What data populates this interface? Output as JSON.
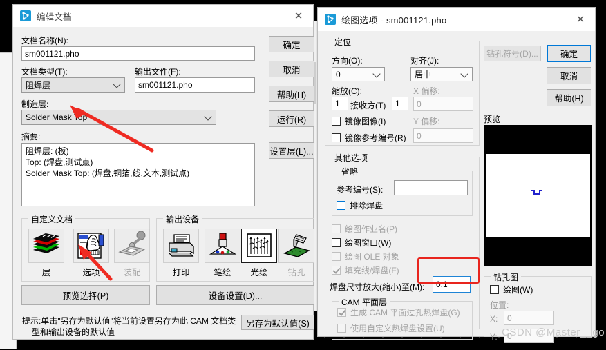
{
  "desktop": {
    "watermark": "CSDN @Master__go"
  },
  "edit_doc": {
    "title": "编辑文档",
    "icon": "route-icon",
    "close": "✕",
    "fields": {
      "doc_name_label": "文档名称(N):",
      "doc_name_value": "sm001121.pho",
      "doc_type_label": "文档类型(T):",
      "doc_type_value": "阻焊层",
      "out_file_label": "输出文件(F):",
      "out_file_value": "sm001121.pho",
      "manuf_layer_label": "制造层:",
      "manuf_layer_value": "Solder Mask Top",
      "summary_label": "摘要:",
      "summary_text": "阻焊层: (板)\nTop: (焊盘,测试点)\nSolder Mask Top: (焊盘,铜箔,线,文本,测试点)"
    },
    "buttons": {
      "ok": "确定",
      "cancel": "取消",
      "help": "帮助(H)",
      "run": "运行(R)",
      "set_layer": "设置层(L)...",
      "preview_select": "预览选择(P)",
      "device_settings": "设备设置(D)...",
      "save_default": "另存为默认值(S)"
    },
    "custom_doc": {
      "title": "自定义文档",
      "items": [
        {
          "caption": "层",
          "icon": "layers-icon",
          "enabled": true,
          "selected": false
        },
        {
          "caption": "选项",
          "icon": "options-hand-icon",
          "enabled": true,
          "selected": false
        },
        {
          "caption": "装配",
          "icon": "robot-arm-icon",
          "enabled": false,
          "selected": false
        }
      ]
    },
    "output_device": {
      "title": "输出设备",
      "items": [
        {
          "caption": "打印",
          "icon": "printer-icon",
          "enabled": true,
          "selected": false
        },
        {
          "caption": "笔绘",
          "icon": "pen-plotter-icon",
          "enabled": true,
          "selected": false
        },
        {
          "caption": "光绘",
          "icon": "photo-plotter-icon",
          "enabled": true,
          "selected": true
        },
        {
          "caption": "钻孔",
          "icon": "drill-icon",
          "enabled": false,
          "selected": false
        }
      ]
    },
    "hint_line1": "提示:单击\"另存为默认值\"将当前设置另存为此 CAM 文档类",
    "hint_line2": "型和输出设备的默认值"
  },
  "plot_options": {
    "title": "绘图选项 - sm001121.pho",
    "icon": "route-icon",
    "close": "✕",
    "position_group": {
      "title": "定位",
      "direction_label": "方向(O):",
      "direction_value": "0",
      "align_label": "对齐(J):",
      "align_value": "居中",
      "scale_label": "缩放(C):",
      "scale_value": "1",
      "receive_label": "接收方(T)",
      "receive_value": "1",
      "x_offset_label": "X 偏移:",
      "x_offset_value": "0",
      "y_offset_label": "Y 偏移:",
      "y_offset_value": "0",
      "mirror_image": "镜像图像(I)",
      "mirror_refdes": "镜像参考编号(R)"
    },
    "other_group": {
      "title": "其他选项",
      "omit_group": {
        "title": "省略",
        "refdes_label": "参考编号(S):",
        "refdes_value": "",
        "exclude_pad": "排除焊盘"
      },
      "checkboxes": [
        {
          "label": "绘图作业名(P)",
          "enabled": false,
          "checked": false
        },
        {
          "label": "绘图窗口(W)",
          "enabled": true,
          "checked": false
        },
        {
          "label": "绘图 OLE 对象",
          "enabled": false,
          "checked": false
        },
        {
          "label": "填充线/焊盘(F)",
          "enabled": false,
          "checked": true
        }
      ],
      "pad_scale_label": "焊盘尺寸放大(缩小)至(M):",
      "pad_scale_value": "0.1",
      "cam_group": {
        "title": "CAM 平面层",
        "gen_cam": "生成 CAM 平面过孔热焊盘(G)",
        "use_custom": "使用自定义热焊盘设置(U)"
      }
    },
    "right": {
      "drill_symbol_btn": "钻孔符号(D)...",
      "ok": "确定",
      "cancel": "取消",
      "help": "帮助(H)",
      "preview_label": "预览",
      "drill_fig_group": {
        "title": "钻孔图",
        "plot_label": "绘图(W)",
        "position_label": "位置:",
        "x_label": "X:",
        "x_value": "0",
        "y_label": "Y:",
        "y_value": "0"
      }
    }
  },
  "annotations": {
    "highlight_color": "#e8251e",
    "arrow_color": "#e8251e"
  }
}
